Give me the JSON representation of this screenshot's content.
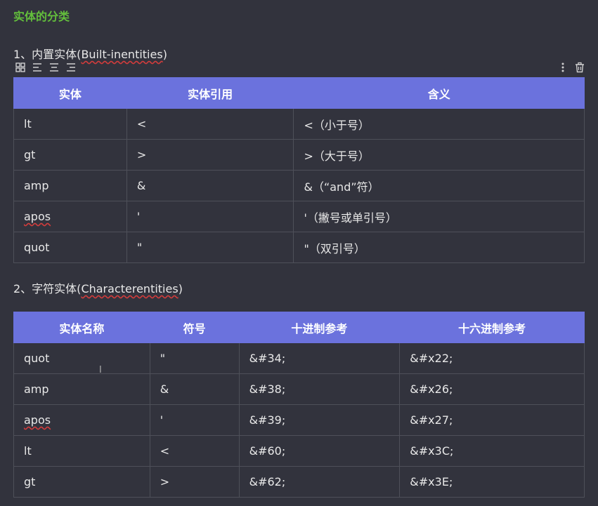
{
  "heading": "实体的分类",
  "section1": {
    "title_prefix": "1、内置实体(",
    "title_en": "Built-inentities",
    "title_suffix": ")",
    "headers": [
      "实体",
      "实体引用",
      "含义"
    ],
    "rows": [
      [
        "lt",
        "<",
        "<（小于号）"
      ],
      [
        "gt",
        ">",
        ">（大于号）"
      ],
      [
        "amp",
        "&",
        "&（“and”符）"
      ],
      [
        "apos",
        "'",
        "'（撇号或单引号）"
      ],
      [
        "quot",
        "\"",
        "\"（双引号）"
      ]
    ]
  },
  "section2": {
    "title_prefix": "2、字符实体(",
    "title_en": "Characterentities",
    "title_suffix": ")",
    "headers": [
      "实体名称",
      "符号",
      "十进制参考",
      "十六进制参考"
    ],
    "rows": [
      [
        "quot",
        "\"",
        "&#34;",
        "&#x22;"
      ],
      [
        "amp",
        "&",
        "&#38;",
        "&#x26;"
      ],
      [
        "apos",
        "'",
        "&#39;",
        "&#x27;"
      ],
      [
        "lt",
        "<",
        "&#60;",
        "&#x3C;"
      ],
      [
        "gt",
        ">",
        "&#62;",
        "&#x3E;"
      ]
    ]
  },
  "toolbar": {
    "left_icons": [
      "grid-icon",
      "align-left-icon",
      "align-center-icon",
      "align-right-icon"
    ],
    "right_icons": [
      "more-vertical-icon",
      "trash-icon"
    ]
  },
  "colors": {
    "background": "#32333d",
    "heading": "#63bf3c",
    "table_header": "#6b72dd",
    "border": "#4e5059"
  }
}
